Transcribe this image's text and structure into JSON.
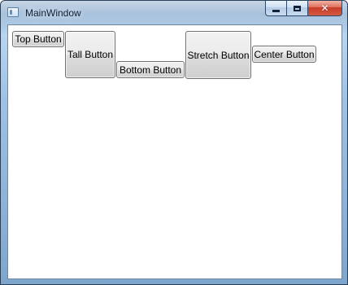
{
  "window": {
    "title": "MainWindow",
    "caption_buttons": {
      "minimize_icon": "minimize-icon",
      "maximize_icon": "maximize-icon",
      "close_icon": "close-icon"
    },
    "app_icon": "window-icon"
  },
  "buttons": [
    {
      "label": "Top Button"
    },
    {
      "label": "Tall Button"
    },
    {
      "label": "Bottom Button"
    },
    {
      "label": "Stretch Button"
    },
    {
      "label": "Center Button"
    }
  ]
}
